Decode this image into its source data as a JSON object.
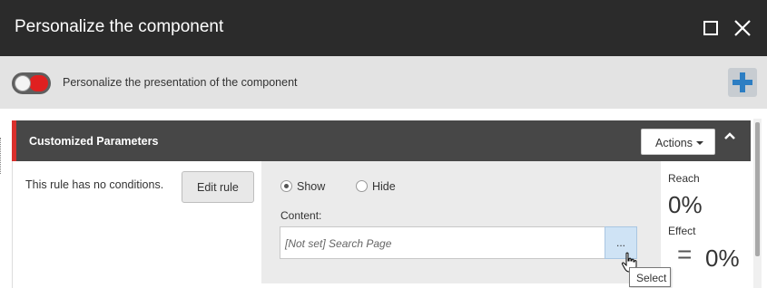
{
  "window": {
    "title": "Personalize the component"
  },
  "toolbar": {
    "toggle_label": "Personalize the presentation of the component",
    "toggle_on": true
  },
  "rule": {
    "name": "Customized Parameters",
    "actions_label": "Actions",
    "condition_text": "This rule has no conditions.",
    "edit_rule_label": "Edit rule",
    "options": [
      {
        "label": "Show",
        "selected": true
      },
      {
        "label": "Hide",
        "selected": false
      }
    ],
    "content_label": "Content:",
    "content_value": "[Not set] Search Page",
    "browse_label": "...",
    "reach_label": "Reach",
    "reach_value": "0%",
    "effect_label": "Effect",
    "effect_symbol": "=",
    "effect_value": "0%"
  },
  "tooltip": {
    "text": "Select"
  },
  "colors": {
    "titlebar": "#2b2b2b",
    "toolbar": "#e3e3e3",
    "rule_header": "#474747",
    "accent_red": "#d9302c",
    "add_blue": "#2d7ec3",
    "browse_bg": "#cfe3f5"
  },
  "icons": {
    "maximize": "maximize-icon",
    "close": "close-icon",
    "add": "plus-icon",
    "collapse": "chevron-up-icon",
    "actions_caret": "caret-down-icon",
    "cursor": "hand-pointer-icon"
  }
}
